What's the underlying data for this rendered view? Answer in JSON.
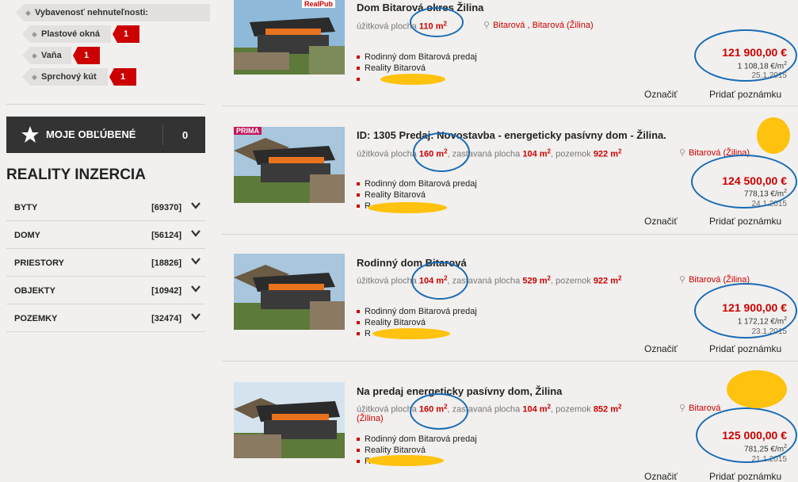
{
  "sidebar": {
    "filter_title": "Vybavenosť nehnuteľnosti:",
    "filters": [
      {
        "label": "Plastové okná",
        "count": "1"
      },
      {
        "label": "Vaňa",
        "count": "1"
      },
      {
        "label": "Sprchový kút",
        "count": "1"
      }
    ],
    "favorites": {
      "label": "MOJE OBĽÚBENÉ",
      "count": "0"
    },
    "section_title": "REALITY INZERCIA",
    "categories": [
      {
        "name": "BYTY",
        "count": "[69370]"
      },
      {
        "name": "DOMY",
        "count": "[56124]"
      },
      {
        "name": "PRIESTORY",
        "count": "[18826]"
      },
      {
        "name": "OBJEKTY",
        "count": "[10942]"
      },
      {
        "name": "POZEMKY",
        "count": "[32474]"
      }
    ]
  },
  "listings": [
    {
      "title": "Dom Bitarová okres Žilina",
      "area_label": "úžitková plocha",
      "area_value": "110 m",
      "location": "Bitarová , Bitarová (Žilina)",
      "features": [
        "Rodinný dom Bitarová predaj",
        "Reality Bitarová",
        ""
      ],
      "price": "121 900,00 €",
      "price_per_m2": "1 108,18 €/m",
      "date": "25.1.2015",
      "mark": "Označiť",
      "note": "Pridať poznámku",
      "thumb_badge": "RealPub"
    },
    {
      "title": "ID: 1305 Predaj: Novostavba - energeticky pasívny dom - Žilina.",
      "area_label": "úžitková plocha",
      "area_value": "160 m",
      "built_label": ", zastavaná plocha",
      "built_value": "104 m",
      "land_label": ", pozemok",
      "land_value": "922 m",
      "location": "Bitarová (Žilina)",
      "features": [
        "Rodinný dom Bitarová predaj",
        "Reality Bitarová",
        "R"
      ],
      "price": "124 500,00 €",
      "price_per_m2": "778,13 €/m",
      "date": "24.1.2015",
      "mark": "Označiť",
      "note": "Pridať poznámku",
      "thumb_badge": "PRIMA"
    },
    {
      "title": "Rodinný dom Bitarová",
      "area_label": "úžitková plocha",
      "area_value": "104 m",
      "built_label": ", zastavaná plocha",
      "built_value": "529 m",
      "land_label": ", pozemok",
      "land_value": "922 m",
      "location": "Bitarová (Žilina)",
      "features": [
        "Rodinný dom Bitarová predaj",
        "Reality Bitarová",
        "R"
      ],
      "price": "121 900,00 €",
      "price_per_m2": "1 172,12 €/m",
      "date": "23.1.2015",
      "mark": "Označiť",
      "note": "Pridať poznámku"
    },
    {
      "title": "Na predaj energeticky pasívny dom, Žilina",
      "area_label": "úžitková plocha",
      "area_value": "160 m",
      "built_label": ", zastavaná plocha",
      "built_value": "104 m",
      "land_label": ", pozemok",
      "land_value": "852 m",
      "location": "Bitarová",
      "location2": "(Žilina)",
      "features": [
        "Rodinný dom Bitarová predaj",
        "Reality Bitarová",
        "R"
      ],
      "price": "125 000,00 €",
      "price_per_m2": "781,25 €/m",
      "date": "21.1.2015",
      "mark": "Označiť",
      "note": "Pridať poznámku"
    }
  ],
  "colors": {
    "accent": "#cc0000",
    "annotation_ring": "#1a6bb5",
    "annotation_blob": "#ffc20e",
    "dark_box": "#333333"
  }
}
